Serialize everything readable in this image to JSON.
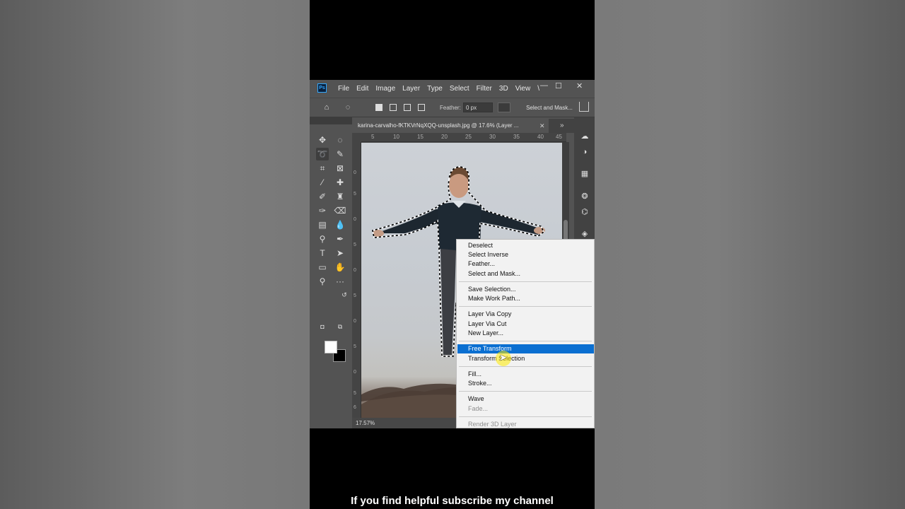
{
  "app": {
    "logo": "Ps",
    "menus": [
      "File",
      "Edit",
      "Image",
      "Layer",
      "Type",
      "Select",
      "Filter",
      "3D",
      "View",
      "\\"
    ],
    "window_controls": {
      "minimize": "—",
      "maximize": "☐",
      "close": "✕"
    }
  },
  "options_bar": {
    "feather_label": "Feather:",
    "feather_value": "0 px",
    "select_and_mask": "Select and Mask..."
  },
  "document": {
    "tab_title": "karina-carvalho-fKTKVrNqXQQ-unsplash.jpg @ 17.6% (Layer ...",
    "zoom": "17.57%",
    "ruler_h": [
      "5",
      "10",
      "15",
      "20",
      "25",
      "30",
      "35",
      "40",
      "45"
    ],
    "ruler_v": [
      "0",
      "5",
      "0",
      "5",
      "0",
      "5",
      "0",
      "5",
      "0",
      "5",
      "6"
    ]
  },
  "context_menu": {
    "groups": [
      [
        "Deselect",
        "Select Inverse",
        "Feather...",
        "Select and Mask..."
      ],
      [
        "Save Selection...",
        "Make Work Path..."
      ],
      [
        "Layer Via Copy",
        "Layer Via Cut",
        "New Layer..."
      ],
      [
        "Free Transform",
        "Transform Selection"
      ],
      [
        "Fill...",
        "Stroke..."
      ],
      [
        "Wave",
        "Fade..."
      ],
      [
        "Render 3D Layer"
      ]
    ],
    "selected": "Free Transform",
    "disabled": [
      "Fade...",
      "Render 3D Layer"
    ]
  },
  "caption": "If you find helpful subscribe my channel"
}
